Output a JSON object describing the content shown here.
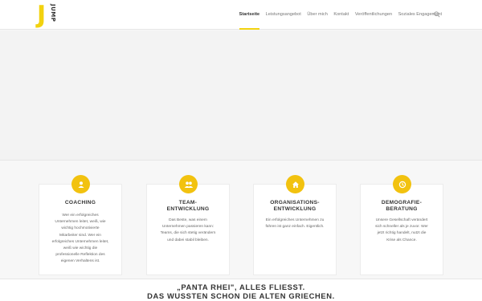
{
  "header": {
    "logo_letter": "J",
    "logo_word": "JUMP",
    "nav": [
      "Startseite",
      "Leistungsangebot",
      "Über mich",
      "Kontakt",
      "Veröffentlichungen",
      "Soziales Engagement"
    ]
  },
  "services": [
    {
      "icon": "person-icon",
      "title": "COACHING",
      "text": [
        "Wer ein erfolgreiches",
        "Unternehmen leitet, weiß, wie",
        "wichtig hochmotivierte",
        "Mitarbeiter sind. Wer ein",
        "erfolgreiches Unternehmen leitet,",
        "weiß wie wichtig die",
        "professionelle Reflektion des",
        "eigenen Verhaltens ist."
      ]
    },
    {
      "icon": "team-icon",
      "title": [
        "TEAM-",
        "ENTWICKLUNG"
      ],
      "text": [
        "Das Beste, was einem",
        "Unternehmen passieren kann:",
        "Teams, die sich stetig verändern",
        "und dabei stabil bleiben."
      ]
    },
    {
      "icon": "home-icon",
      "title": [
        "ORGANISATIONS-",
        "ENTWICKLUNG"
      ],
      "text": [
        "Ein erfolgreiches Unternehmen zu",
        "führen ist ganz einfach. Eigentlich."
      ]
    },
    {
      "icon": "clock-icon",
      "title": [
        "DEMOGRAFIE-",
        "BERATUNG"
      ],
      "text": [
        "Unsere Gesellschaft verändert",
        "sich schneller als je zuvor. Wer",
        "jetzt richtig handelt, nutzt die",
        "Krise als Chance."
      ]
    }
  ],
  "quote": {
    "line1": "„PANTA RHEI\", ALLES FLIESST.",
    "line2": "DAS WUSSTEN SCHON DIE ALTEN GRIECHEN."
  },
  "colors": {
    "accent": "#f2c20f",
    "text": "#333333"
  }
}
